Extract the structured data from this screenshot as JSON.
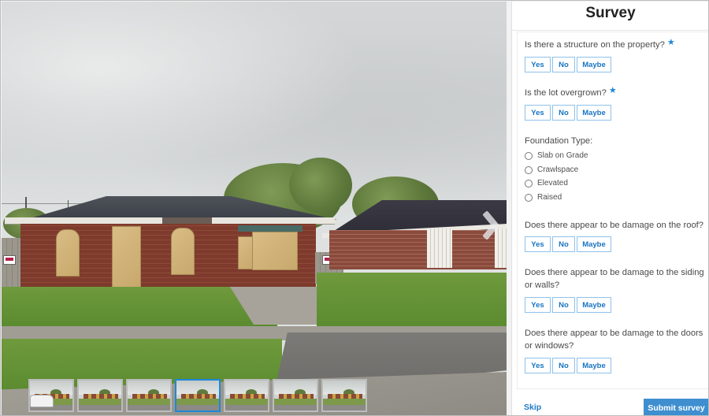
{
  "panel": {
    "title": "Survey",
    "required_marker": "★",
    "questions": [
      {
        "text": "Is there a structure on the property?",
        "required": true,
        "options": [
          "Yes",
          "No",
          "Maybe"
        ]
      },
      {
        "text": "Is the lot overgrown?",
        "required": true,
        "options": [
          "Yes",
          "No",
          "Maybe"
        ]
      },
      {
        "text": "Foundation Type:",
        "required": false,
        "radio_options": [
          "Slab on Grade",
          "Crawlspace",
          "Elevated",
          "Raised"
        ],
        "selected": null
      },
      {
        "text": "Does there appear to be damage on the roof?",
        "required": false,
        "options": [
          "Yes",
          "No",
          "Maybe"
        ]
      },
      {
        "text": "Does there appear to be damage to the siding or walls?",
        "required": false,
        "options": [
          "Yes",
          "No",
          "Maybe"
        ]
      },
      {
        "text": "Does there appear to be damage to the doors or windows?",
        "required": false,
        "options": [
          "Yes",
          "No",
          "Maybe"
        ]
      }
    ],
    "footer": {
      "skip_label": "Skip",
      "submit_label": "Submit survey"
    }
  },
  "viewer": {
    "image_description": "Street-level photo of a boarded-up brick house",
    "next_icon": "chevron-right-icon",
    "thumbnails": {
      "count": 7,
      "selected_index": 3
    }
  },
  "colors": {
    "accent": "#1f86d6",
    "submit_bg": "#3f8fd0",
    "button_border": "#8ec1ea",
    "selected_thumb_border": "#1e88d8"
  }
}
